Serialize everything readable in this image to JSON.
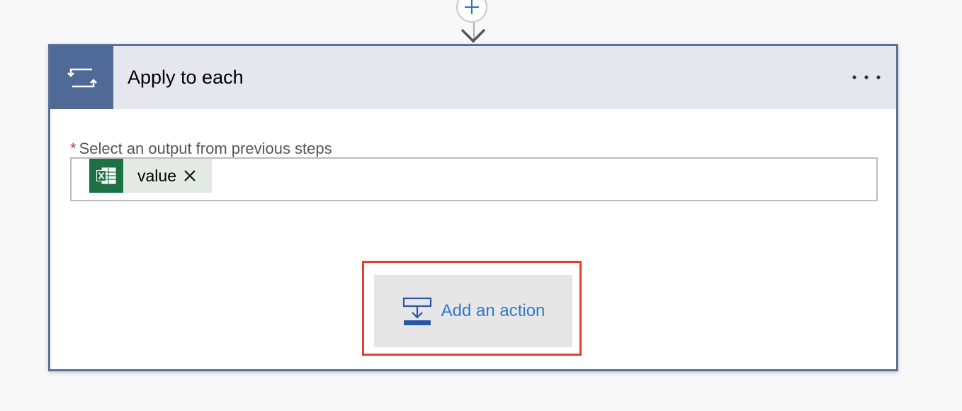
{
  "connector": {
    "insert_icon": "plus-icon",
    "arrow_icon": "chevron-down-icon"
  },
  "card": {
    "title": "Apply to each",
    "icon": "loop-icon",
    "more_icon": "ellipsis-icon",
    "accent_color": "#4f6a96",
    "field": {
      "required_mark": "*",
      "label": "Select an output from previous steps",
      "token": {
        "icon": "excel-icon",
        "label": "value",
        "remove_icon": "close-icon"
      }
    },
    "add_action": {
      "icon": "add-action-icon",
      "label": "Add an action",
      "highlight_color": "#e2402c"
    }
  }
}
